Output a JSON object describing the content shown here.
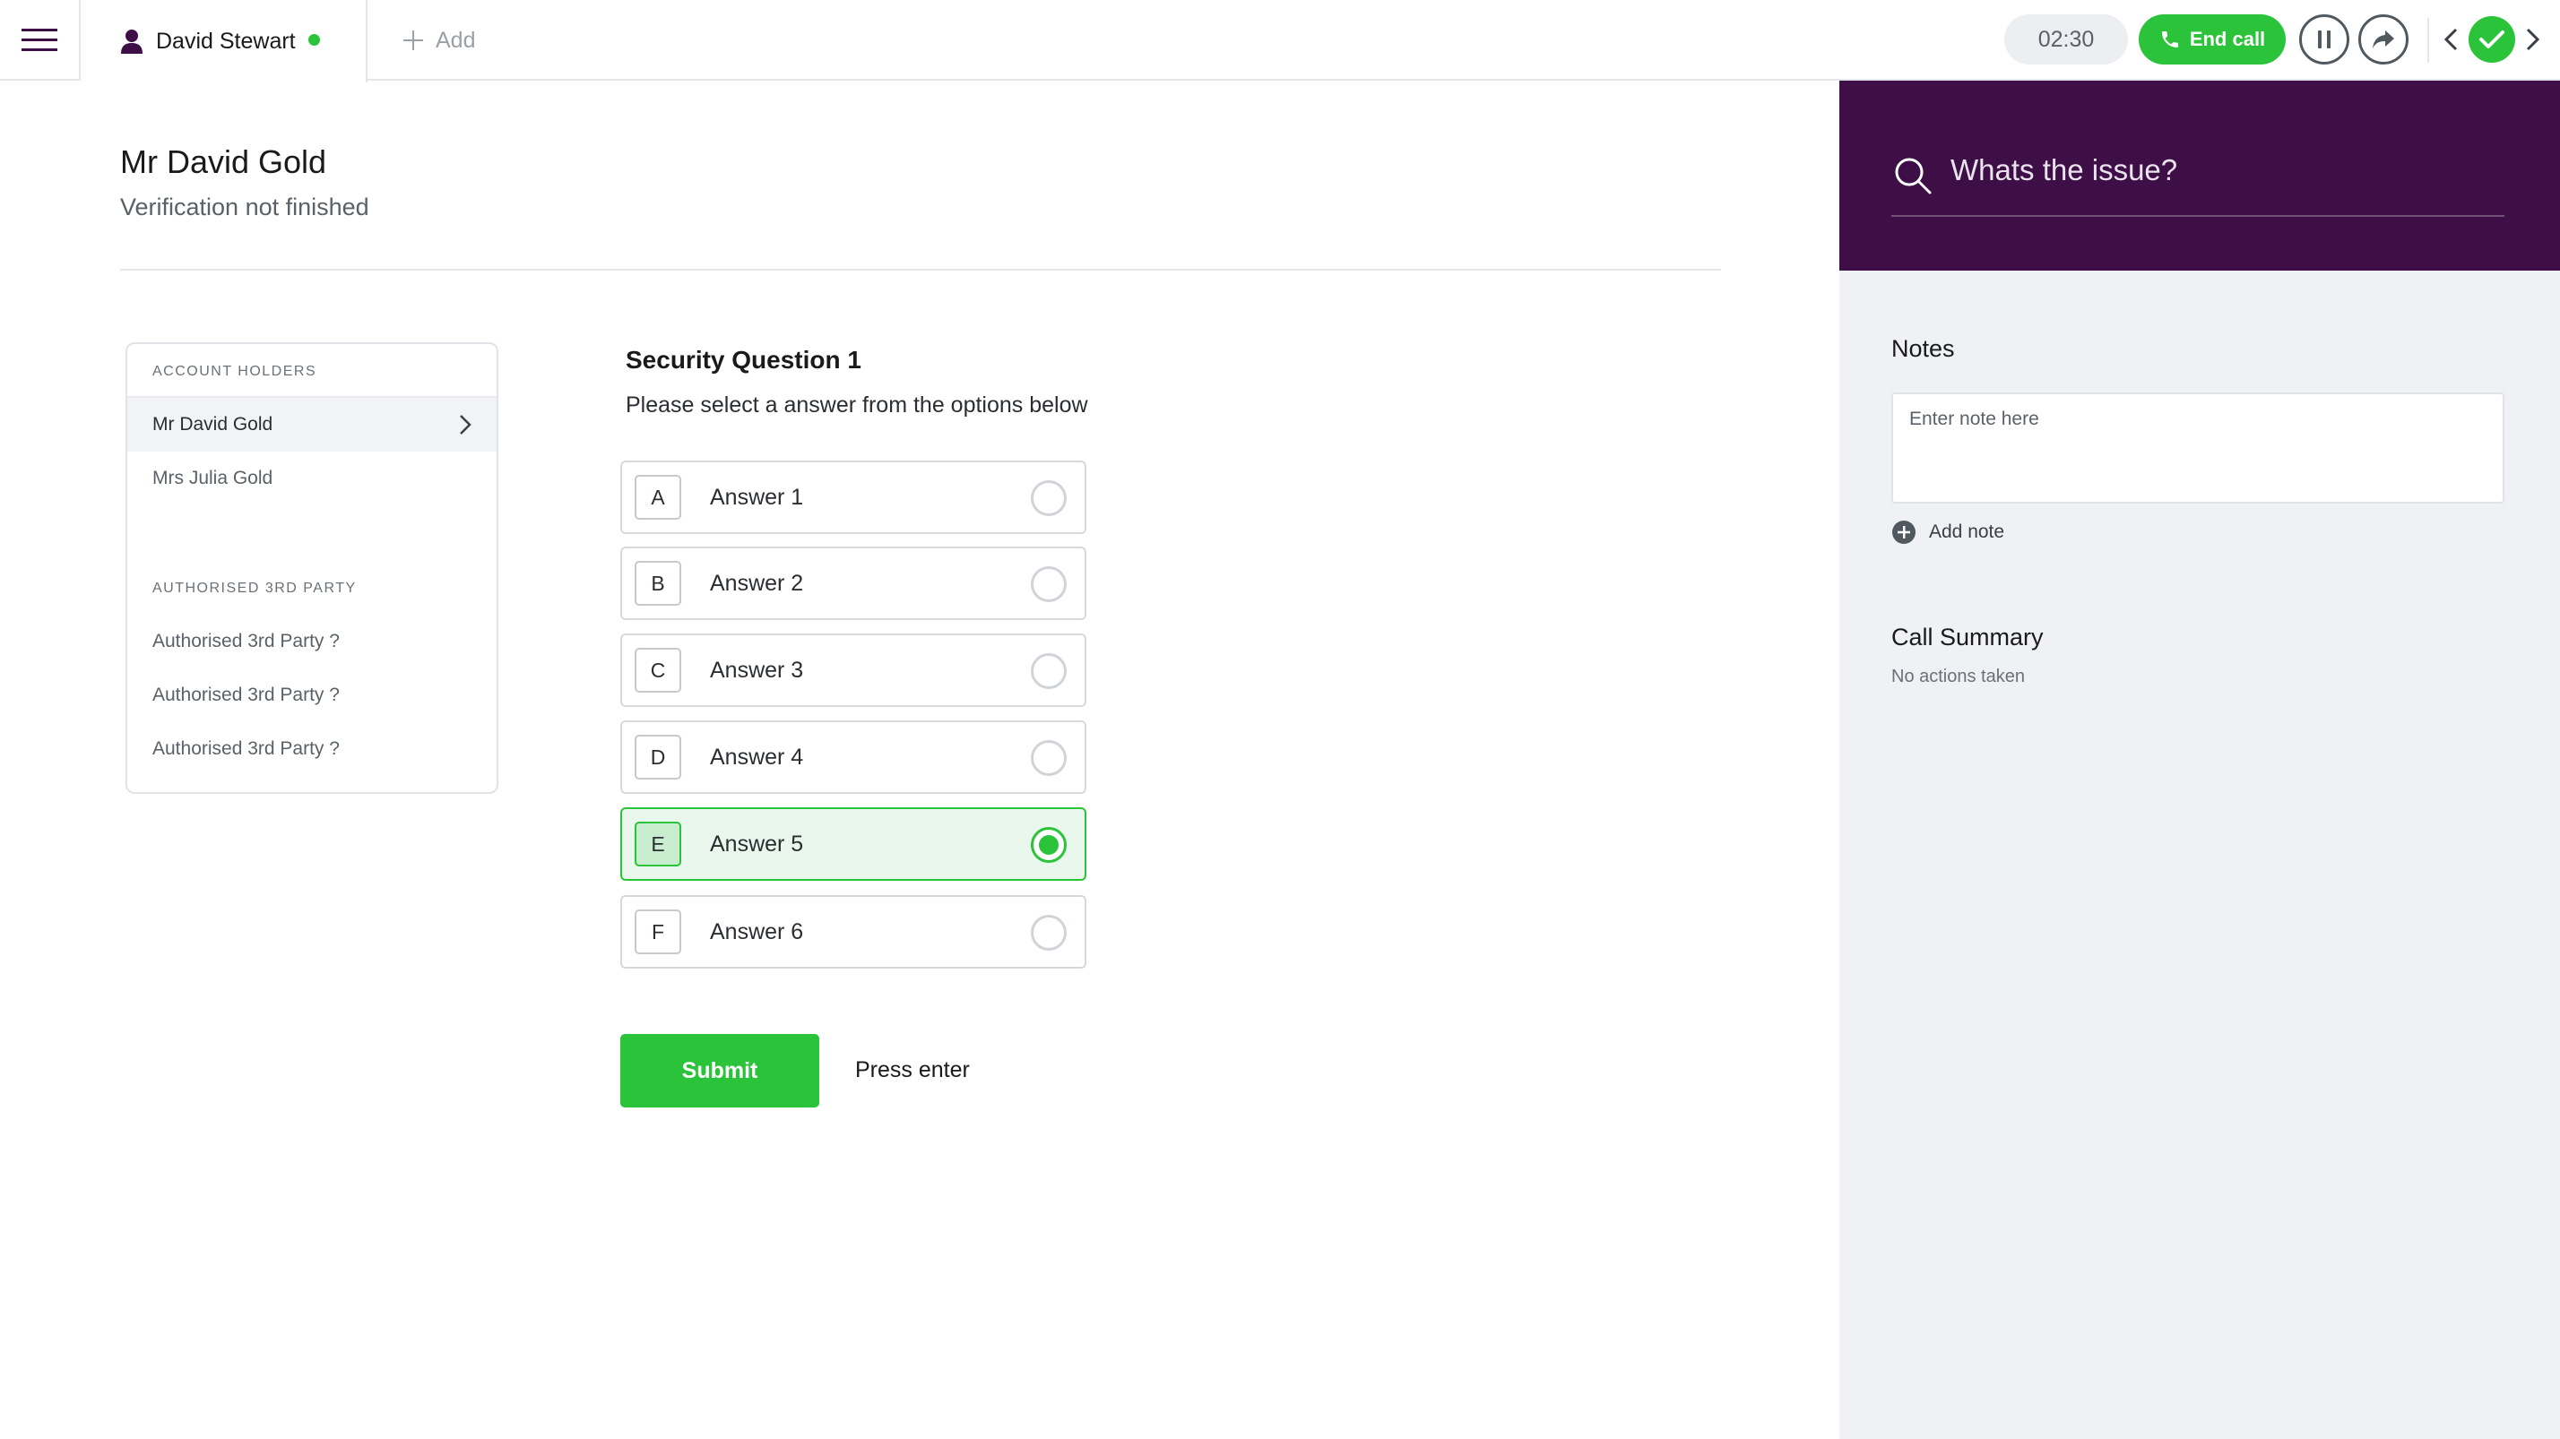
{
  "header": {
    "customer_tab": {
      "name": "David Stewart",
      "status": "online"
    },
    "add_tab_label": "Add",
    "timer": "02:30",
    "end_call_label": "End call"
  },
  "customer": {
    "name": "Mr David Gold",
    "verification_status": "Verification not finished"
  },
  "holders_card": {
    "account_holders_header": "ACCOUNT HOLDERS",
    "account_holders": [
      "Mr David Gold",
      "Mrs Julia Gold"
    ],
    "selected_holder": "Mr David Gold",
    "third_party_header": "AUTHORISED 3RD PARTY",
    "third_parties": [
      "Authorised 3rd Party ?",
      "Authorised 3rd Party ?",
      "Authorised 3rd Party ?"
    ]
  },
  "question": {
    "title": "Security Question 1",
    "instruction": "Please select a answer from the options below",
    "answers": [
      {
        "letter": "A",
        "text": "Answer 1"
      },
      {
        "letter": "B",
        "text": "Answer 2"
      },
      {
        "letter": "C",
        "text": "Answer 3"
      },
      {
        "letter": "D",
        "text": "Answer 4"
      },
      {
        "letter": "E",
        "text": "Answer 5"
      },
      {
        "letter": "F",
        "text": "Answer 6"
      }
    ],
    "selected_answer": "E"
  },
  "actions": {
    "submit_label": "Submit",
    "hint": "Press enter"
  },
  "right_panel": {
    "search_placeholder": "Whats the issue?",
    "notes_title": "Notes",
    "note_placeholder": "Enter note here",
    "add_note_label": "Add note",
    "call_summary_title": "Call Summary",
    "call_summary_text": "No actions taken"
  },
  "colors": {
    "accent_green": "#2bc33a",
    "brand_purple": "#3d0f46",
    "panel_background": "#eff1f4"
  },
  "icons": [
    "hamburger-menu-icon",
    "user-icon",
    "plus-icon",
    "phone-icon",
    "pause-icon",
    "forward-icon",
    "chevron-left-icon",
    "check-icon",
    "chevron-right-icon",
    "search-icon",
    "add-circle-icon"
  ]
}
